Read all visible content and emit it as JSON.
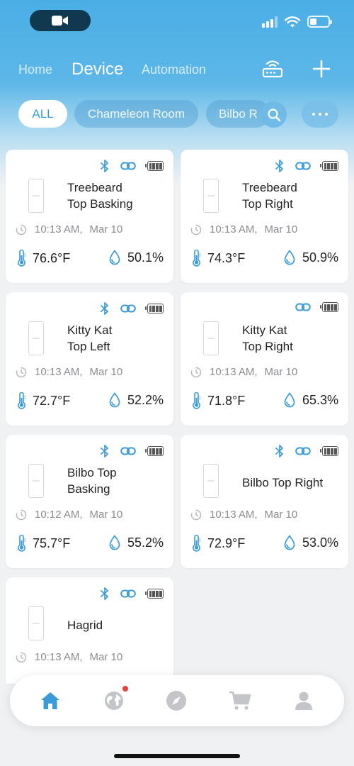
{
  "header": {
    "tabs": [
      {
        "label": "Home",
        "active": false
      },
      {
        "label": "Device",
        "active": true
      },
      {
        "label": "Automation",
        "active": false
      }
    ]
  },
  "filters": {
    "chips": [
      "ALL",
      "Chameleon Room",
      "Bilbo R"
    ],
    "active": "ALL"
  },
  "devices": [
    {
      "name_line1": "Treebeard",
      "name_line2": "Top Basking",
      "time": "10:13 AM,",
      "date": "Mar 10",
      "temperature": "76.6°F",
      "humidity": "50.1%",
      "bluetooth": true
    },
    {
      "name_line1": "Treebeard",
      "name_line2": "Top Right",
      "time": "10:13 AM,",
      "date": "Mar 10",
      "temperature": "74.3°F",
      "humidity": "50.9%",
      "bluetooth": true
    },
    {
      "name_line1": "Kitty Kat",
      "name_line2": "Top Left",
      "time": "10:13 AM,",
      "date": "Mar 10",
      "temperature": "72.7°F",
      "humidity": "52.2%",
      "bluetooth": true
    },
    {
      "name_line1": "Kitty Kat",
      "name_line2": "Top Right",
      "time": "10:13 AM,",
      "date": "Mar 10",
      "temperature": "71.8°F",
      "humidity": "65.3%",
      "bluetooth": false
    },
    {
      "name_line1": "Bilbo Top",
      "name_line2": "Basking",
      "time": "10:12 AM,",
      "date": "Mar 10",
      "temperature": "75.7°F",
      "humidity": "55.2%",
      "bluetooth": true
    },
    {
      "name_line1": "Bilbo Top Right",
      "name_line2": "",
      "time": "10:13 AM,",
      "date": "Mar 10",
      "temperature": "72.9°F",
      "humidity": "53.0%",
      "bluetooth": true
    },
    {
      "name_line1": "Hagrid",
      "name_line2": "",
      "time": "10:13 AM,",
      "date": "Mar 10",
      "temperature": "",
      "humidity": "",
      "bluetooth": true
    }
  ],
  "bottom_nav": {
    "items": [
      "home-icon",
      "globe-icon",
      "compass-icon",
      "cart-icon",
      "profile-icon"
    ],
    "active": "home-icon",
    "notification_on": "globe-icon"
  },
  "colors": {
    "accent": "#3a9bd8",
    "header_blue": "#4aaee5",
    "notification": "#e94040"
  }
}
